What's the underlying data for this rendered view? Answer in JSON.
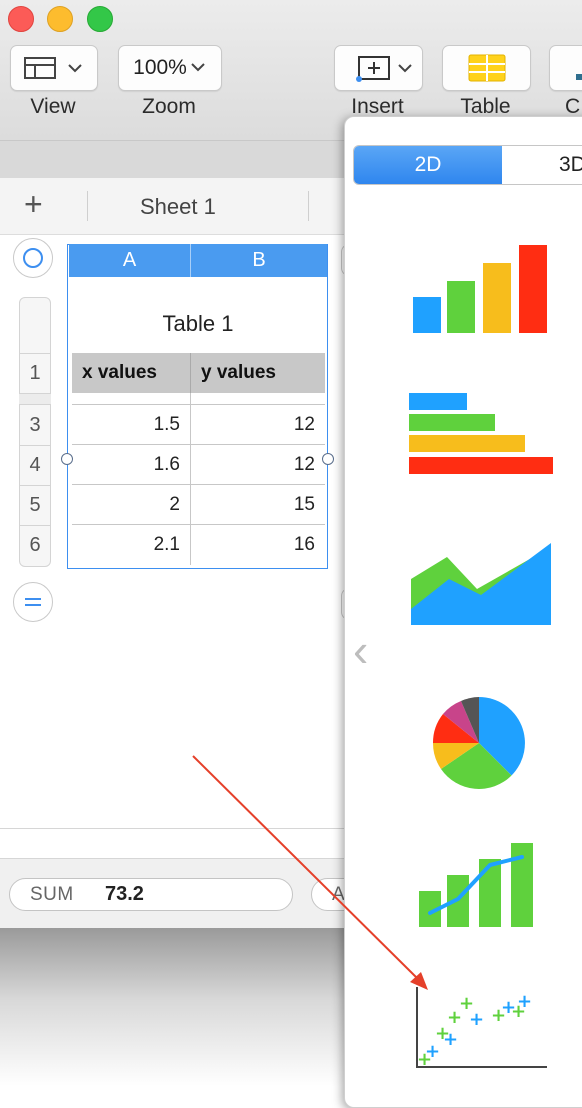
{
  "toolbar": {
    "view_label": "View",
    "zoom_value": "100%",
    "zoom_label": "Zoom",
    "insert_label": "Insert",
    "table_label": "Table",
    "cut_label": "C"
  },
  "sheet": {
    "add_label": "+",
    "tab_name": "Sheet 1"
  },
  "table": {
    "title": "Table 1",
    "columns": [
      "A",
      "B"
    ],
    "headers": [
      "x values",
      "y values"
    ],
    "header_row_num": "1",
    "rows": [
      {
        "num": "3",
        "x": "1.5",
        "y": "12"
      },
      {
        "num": "4",
        "x": "1.6",
        "y": "12"
      },
      {
        "num": "5",
        "x": "2",
        "y": "15"
      },
      {
        "num": "6",
        "x": "2.1",
        "y": "16"
      }
    ]
  },
  "status": {
    "sum_label": "SUM",
    "sum_value": "73.2",
    "avg_partial": "A"
  },
  "chart_picker": {
    "tab_2d": "2D",
    "tab_3d": "3D",
    "selected_tab": "2D",
    "back_glyph": "‹",
    "options": [
      "column-chart",
      "bar-chart",
      "area-chart",
      "pie-chart",
      "mixed-chart",
      "scatter-chart"
    ]
  },
  "colors": {
    "accent": "#3d8ff0",
    "annotation_arrow": "#e5402a",
    "chart_blue": "#1fa1ff",
    "chart_green": "#5fd13d",
    "chart_yellow": "#f7bd1c",
    "chart_red": "#ff2d12"
  }
}
